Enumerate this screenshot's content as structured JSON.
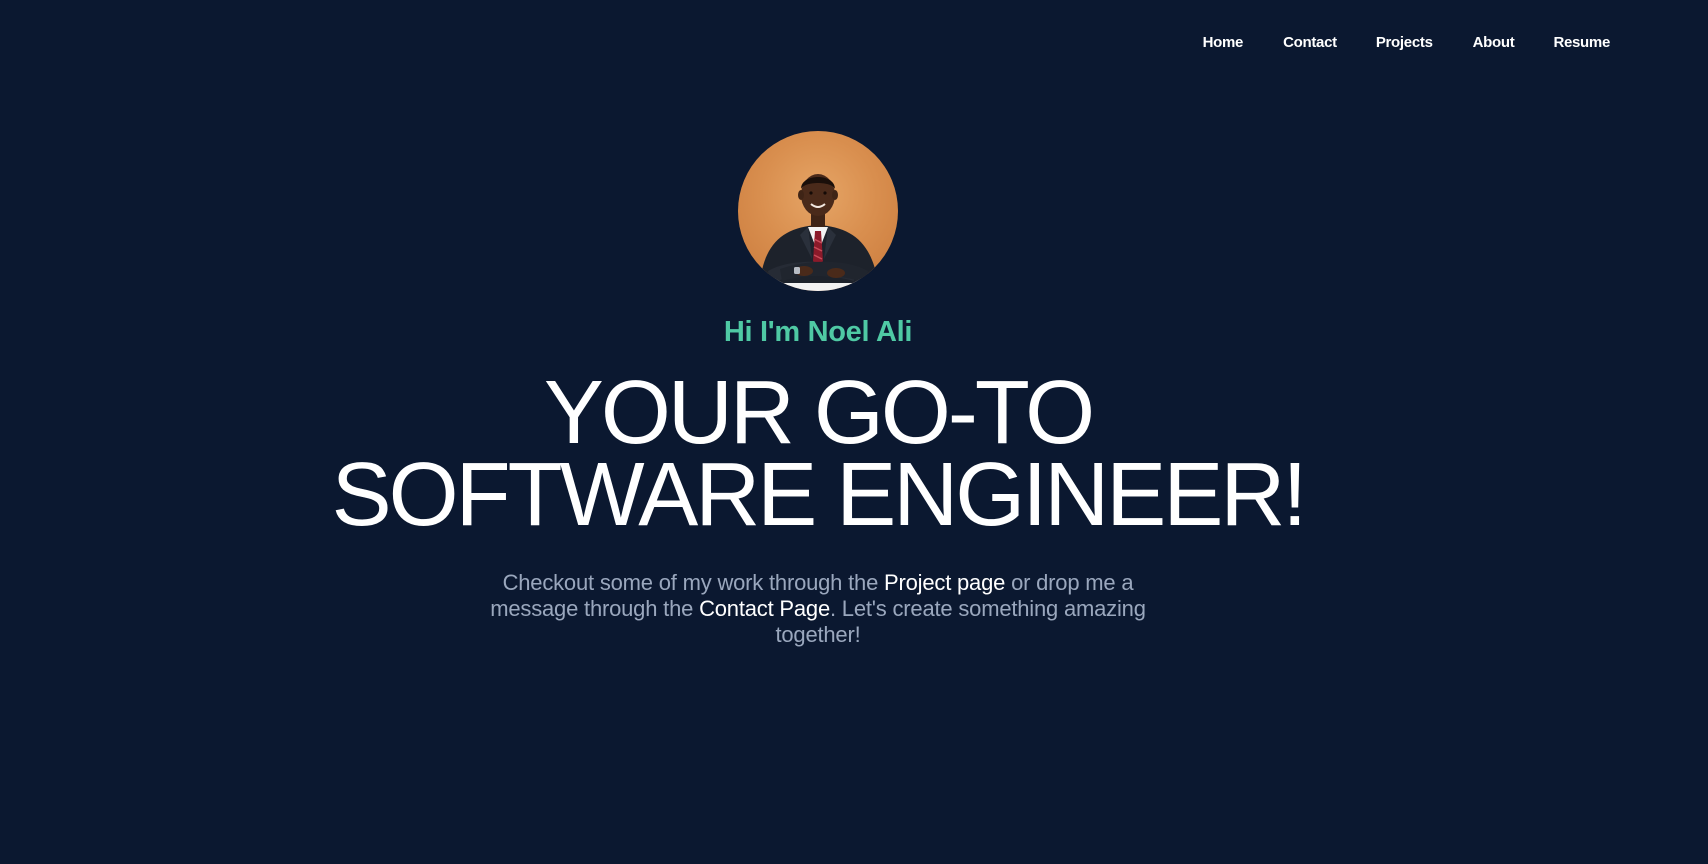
{
  "nav": {
    "items": [
      "Home",
      "Contact",
      "Projects",
      "About",
      "Resume"
    ]
  },
  "hero": {
    "greeting": "Hi I'm Noel Ali",
    "headline_line1": "YOUR GO-TO",
    "headline_line2": "SOFTWARE ENGINEER!",
    "intro": {
      "part1": "Checkout some of my work through the ",
      "project_link": "Project page",
      "part2": " or drop me a message through the ",
      "contact_link": "Contact Page",
      "part3": ". Let's create something amazing together!"
    }
  },
  "colors": {
    "background": "#0b1830",
    "accent": "#4fc9a4",
    "text_muted": "#9aa7bd",
    "text_primary": "#ffffff"
  }
}
